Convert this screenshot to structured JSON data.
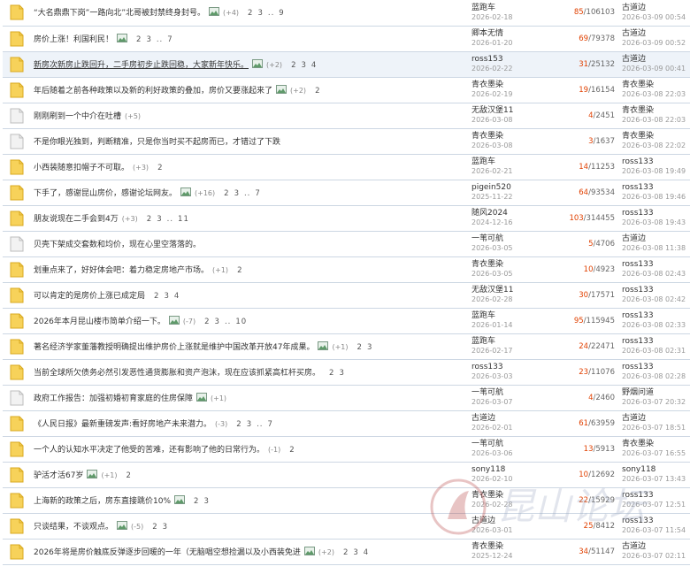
{
  "threads": [
    {
      "title": "“大名鼎鼎下岗”一路向北”北哥被封禁终身封号。",
      "has_image": true,
      "count": "(+4)",
      "pages": [
        "2",
        "3",
        "..",
        "9"
      ],
      "author": "蓝跑车",
      "post_date": "2026-02-18",
      "replies": "85",
      "views": "106103",
      "last_user": "古道边",
      "last_time": "2026-03-09 00:54",
      "icon": "hot",
      "underline": false
    },
    {
      "title": "房价上涨！利国利民！",
      "has_image": true,
      "count": "",
      "pages": [
        "2",
        "3",
        "..",
        "7"
      ],
      "author": "卿本无情",
      "post_date": "2026-01-20",
      "replies": "69",
      "views": "79378",
      "last_user": "古道边",
      "last_time": "2026-03-09 00:52",
      "icon": "hot",
      "underline": false
    },
    {
      "title": "新房次新房止跌回升，二手房初步止跌回稳，大家新年快乐。",
      "has_image": true,
      "count": "(+2)",
      "pages": [
        "2",
        "3",
        "4"
      ],
      "author": "ross153",
      "post_date": "2026-02-22",
      "replies": "31",
      "views": "25132",
      "last_user": "古道边",
      "last_time": "2026-03-09 00:41",
      "icon": "hot",
      "underline": true
    },
    {
      "title": "年后随着之前各种政策以及新的利好政策的叠加，房价又要涨起来了",
      "has_image": true,
      "count": "(+2)",
      "pages": [
        "2"
      ],
      "author": "青衣墨染",
      "post_date": "2026-02-19",
      "replies": "19",
      "views": "16154",
      "last_user": "青衣墨染",
      "last_time": "2026-03-08 22:03",
      "icon": "hot",
      "underline": false
    },
    {
      "title": "刚刚刷到一个中介在吐槽",
      "has_image": false,
      "count": "(+5)",
      "pages": [],
      "author": "无敌汉堡11",
      "post_date": "2026-03-08",
      "replies": "4",
      "views": "2451",
      "last_user": "青衣墨染",
      "last_time": "2026-03-08 22:03",
      "icon": "doc",
      "underline": false
    },
    {
      "title": "不是你眼光独到，判断精准，只是你当时买不起房而已，才错过了下跌",
      "has_image": false,
      "count": "",
      "pages": [],
      "author": "青衣墨染",
      "post_date": "2026-03-08",
      "replies": "3",
      "views": "1637",
      "last_user": "青衣墨染",
      "last_time": "2026-03-08 22:02",
      "icon": "doc",
      "underline": false
    },
    {
      "title": "小西装随意扣帽子不可取。",
      "has_image": false,
      "count": "(+3)",
      "pages": [
        "2"
      ],
      "author": "蓝跑车",
      "post_date": "2026-02-21",
      "replies": "14",
      "views": "11253",
      "last_user": "ross133",
      "last_time": "2026-03-08 19:49",
      "icon": "hot",
      "underline": false
    },
    {
      "title": "下手了，感谢昆山房价，感谢论坛网友。",
      "has_image": true,
      "count": "(+16)",
      "pages": [
        "2",
        "3",
        "..",
        "7"
      ],
      "author": "pigein520",
      "post_date": "2025-11-22",
      "replies": "64",
      "views": "93534",
      "last_user": "ross133",
      "last_time": "2026-03-08 19:46",
      "icon": "hot",
      "underline": false
    },
    {
      "title": "朋友说现在二手会到4万",
      "has_image": false,
      "count": "(+3)",
      "pages": [
        "2",
        "3",
        "..",
        "11"
      ],
      "author": "随风2024",
      "post_date": "2024-12-16",
      "replies": "103",
      "views": "314455",
      "last_user": "ross133",
      "last_time": "2026-03-08 19:43",
      "icon": "hot",
      "underline": false
    },
    {
      "title": "贝壳下架成交套数和均价，现在心里空落落的。",
      "has_image": false,
      "count": "",
      "pages": [],
      "author": "一苇可航",
      "post_date": "2026-03-05",
      "replies": "5",
      "views": "4706",
      "last_user": "古道边",
      "last_time": "2026-03-08 11:38",
      "icon": "doc",
      "underline": false
    },
    {
      "title": "划重点来了，好好体会吧：着力稳定房地产市场。",
      "has_image": false,
      "count": "(+1)",
      "pages": [
        "2"
      ],
      "author": "青衣墨染",
      "post_date": "2026-03-05",
      "replies": "10",
      "views": "4923",
      "last_user": "ross133",
      "last_time": "2026-03-08 02:43",
      "icon": "hot",
      "underline": false
    },
    {
      "title": "可以肯定的是房价上涨已成定局",
      "has_image": false,
      "count": "",
      "pages": [
        "2",
        "3",
        "4"
      ],
      "author": "无敌汉堡11",
      "post_date": "2026-02-28",
      "replies": "30",
      "views": "17571",
      "last_user": "ross133",
      "last_time": "2026-03-08 02:42",
      "icon": "hot",
      "underline": false
    },
    {
      "title": "2026年本月昆山楼市简单介绍一下。",
      "has_image": true,
      "count": "(-7)",
      "pages": [
        "2",
        "3",
        "..",
        "10"
      ],
      "author": "蓝跑车",
      "post_date": "2026-01-14",
      "replies": "95",
      "views": "115945",
      "last_user": "ross133",
      "last_time": "2026-03-08 02:33",
      "icon": "hot",
      "underline": false
    },
    {
      "title": "著名经济学家董藩教授明确提出维护房价上涨就是维护中国改革开放47年成果。",
      "has_image": true,
      "count": "(+1)",
      "pages": [
        "2",
        "3"
      ],
      "author": "蓝跑车",
      "post_date": "2026-02-17",
      "replies": "24",
      "views": "22471",
      "last_user": "ross133",
      "last_time": "2026-03-08 02:31",
      "icon": "hot",
      "underline": false
    },
    {
      "title": "当前全球所欠债务必然引发恶性通货膨胀和资产泡沫，现在应该抓紧高杠杆买房。",
      "has_image": false,
      "count": "",
      "pages": [
        "2",
        "3"
      ],
      "author": "ross133",
      "post_date": "2026-03-03",
      "replies": "23",
      "views": "11076",
      "last_user": "ross133",
      "last_time": "2026-03-08 02:28",
      "icon": "hot",
      "underline": false
    },
    {
      "title": "政府工作报告：加强初婚初育家庭的住房保障",
      "has_image": true,
      "count": "(+1)",
      "pages": [],
      "author": "一苇可航",
      "post_date": "2026-03-07",
      "replies": "4",
      "views": "2460",
      "last_user": "野烟问道",
      "last_time": "2026-03-07 20:32",
      "icon": "doc",
      "underline": false
    },
    {
      "title": "《人民日报》最新重磅发声:看好房地产未来潜力。",
      "has_image": false,
      "count": "(-3)",
      "pages": [
        "2",
        "3",
        "..",
        "7"
      ],
      "author": "古道边",
      "post_date": "2026-02-01",
      "replies": "61",
      "views": "63959",
      "last_user": "古道边",
      "last_time": "2026-03-07 18:51",
      "icon": "hot",
      "underline": false
    },
    {
      "title": "一个人的认知水平决定了他受的苦难，还有影响了他的日常行为。",
      "has_image": false,
      "count": "(-1)",
      "pages": [
        "2"
      ],
      "author": "一苇可航",
      "post_date": "2026-03-06",
      "replies": "13",
      "views": "5913",
      "last_user": "青衣墨染",
      "last_time": "2026-03-07 16:55",
      "icon": "hot",
      "underline": false
    },
    {
      "title": "驴活才活67岁",
      "has_image": true,
      "count": "(+1)",
      "pages": [
        "2"
      ],
      "author": "sony118",
      "post_date": "2026-02-10",
      "replies": "10",
      "views": "12692",
      "last_user": "sony118",
      "last_time": "2026-03-07 13:43",
      "icon": "hot",
      "underline": false
    },
    {
      "title": "上海新的政策之后，房东直接跳价10%",
      "has_image": true,
      "count": "",
      "pages": [
        "2",
        "3"
      ],
      "author": "青衣墨染",
      "post_date": "2026-02-28",
      "replies": "22",
      "views": "15929",
      "last_user": "ross133",
      "last_time": "2026-03-07 12:51",
      "icon": "hot",
      "underline": false
    },
    {
      "title": "只谈结果，不谈观点。",
      "has_image": true,
      "count": "(-5)",
      "pages": [
        "2",
        "3"
      ],
      "author": "古道边",
      "post_date": "2026-03-01",
      "replies": "25",
      "views": "8412",
      "last_user": "ross133",
      "last_time": "2026-03-07 11:54",
      "icon": "hot",
      "underline": false
    },
    {
      "title": "2026年将是房价触底反弹逐步回暖的一年（无脑唱空想捡漏以及小西装免进",
      "has_image": true,
      "count": "(+2)",
      "pages": [
        "2",
        "3",
        "4"
      ],
      "author": "青衣墨染",
      "post_date": "2025-12-24",
      "replies": "34",
      "views": "51147",
      "last_user": "古道边",
      "last_time": "2026-03-07 02:11",
      "icon": "hot",
      "underline": false
    }
  ],
  "colors": {
    "replies": "#e04000",
    "hot_icon": "#f5c642",
    "doc_icon": "#d6d6d6",
    "border": "#cdd7e3",
    "highlight": "#eef3f9"
  },
  "watermark": {
    "text": "昆山论坛",
    "icon": "forum-logo-icon"
  }
}
